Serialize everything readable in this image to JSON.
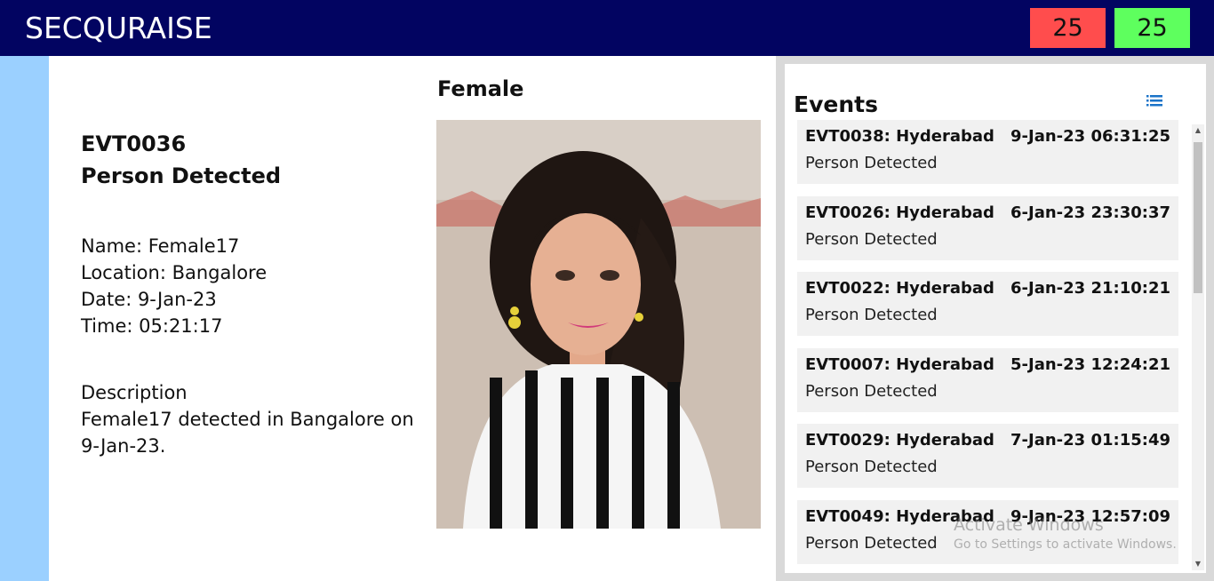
{
  "header": {
    "brand": "SECQURAISE",
    "count_red": "25",
    "count_green": "25"
  },
  "detail": {
    "event_id": "EVT0036",
    "event_type": "Person Detected",
    "name_line": "Name: Female17",
    "location_line": "Location: Bangalore",
    "date_line": "Date: 9-Jan-23",
    "time_line": "Time: 05:21:17",
    "description_label": "Description",
    "description_text": "Female17 detected in Bangalore on 9-Jan-23.",
    "gender": "Female"
  },
  "events": {
    "title": "Events",
    "items": [
      {
        "title": "EVT0038: Hyderabad",
        "time": "9-Jan-23 06:31:25",
        "sub": "Person Detected"
      },
      {
        "title": "EVT0026: Hyderabad",
        "time": "6-Jan-23 23:30:37",
        "sub": "Person Detected"
      },
      {
        "title": "EVT0022: Hyderabad",
        "time": "6-Jan-23 21:10:21",
        "sub": "Person Detected"
      },
      {
        "title": "EVT0007: Hyderabad",
        "time": "5-Jan-23 12:24:21",
        "sub": "Person Detected"
      },
      {
        "title": "EVT0029: Hyderabad",
        "time": "7-Jan-23 01:15:49",
        "sub": "Person Detected"
      },
      {
        "title": "EVT0049: Hyderabad",
        "time": "9-Jan-23 12:57:09",
        "sub": "Person Detected"
      }
    ]
  },
  "watermark": {
    "line1": "Activate Windows",
    "line2": "Go to Settings to activate Windows."
  },
  "icons": {
    "list": "list-icon",
    "scroll_up": "chevron-up-icon",
    "scroll_down": "chevron-down-icon"
  },
  "colors": {
    "header_bg": "#020461",
    "count_red": "#ff4d4d",
    "count_green": "#5eff5e",
    "left_strip": "#9bd0ff",
    "accent": "#1a73c8"
  }
}
